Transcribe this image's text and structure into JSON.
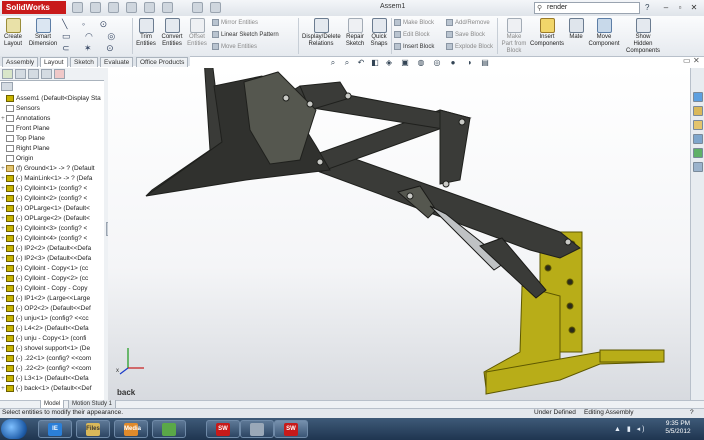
{
  "window": {
    "app_name": "SolidWorks",
    "doc_title": "Assem1",
    "search_placeholder": "render",
    "help": "?",
    "win_controls": [
      "–",
      "▫",
      "✕"
    ]
  },
  "ribbon": {
    "buttons": [
      {
        "label": "Create\nLayout"
      },
      {
        "label": "Smart\nDimension"
      },
      {
        "label": "Trim\nEntities"
      },
      {
        "label": "Convert\nEntities"
      },
      {
        "label": "Offset\nEntities"
      },
      {
        "label": "Display/Delete\nRelations"
      },
      {
        "label": "Repair\nSketch"
      },
      {
        "label": "Quick\nSnaps"
      },
      {
        "label": "Make\nPart from\nBlock"
      },
      {
        "label": "Insert\nComponents"
      },
      {
        "label": "Mate"
      },
      {
        "label": "Move\nComponent"
      },
      {
        "label": "Show\nHidden\nComponents"
      }
    ],
    "small": {
      "mirror": "Mirror Entities",
      "linear_pattern": "Linear Sketch Pattern",
      "move": "Move Entities",
      "make_block": "Make Block",
      "edit_block": "Edit Block",
      "insert_block": "Insert Block",
      "add_remove": "Add/Remove",
      "save_block": "Save Block",
      "explode_block": "Explode Block"
    }
  },
  "command_tabs": [
    "Assembly",
    "Layout",
    "Sketch",
    "Evaluate",
    "Office Products"
  ],
  "command_tab_active": "Layout",
  "tree": [
    {
      "t": "Assem1  (Default<Display Stat",
      "pm": "",
      "icon": "a"
    },
    {
      "t": "Sensors",
      "pm": "",
      "icon": "p"
    },
    {
      "t": "Annotations",
      "pm": "+",
      "icon": "p"
    },
    {
      "t": "Front Plane",
      "pm": "",
      "icon": "p"
    },
    {
      "t": "Top Plane",
      "pm": "",
      "icon": "p"
    },
    {
      "t": "Right Plane",
      "pm": "",
      "icon": "p"
    },
    {
      "t": "Origin",
      "pm": "",
      "icon": "p"
    },
    {
      "t": "(f) Ground<1> -> ? (Default",
      "pm": "+",
      "icon": "f"
    },
    {
      "t": "(-) MainLink<1> -> ? (Defa",
      "pm": "+",
      "icon": "a"
    },
    {
      "t": "(-) Cylloint<1> (config? <",
      "pm": "+",
      "icon": "a"
    },
    {
      "t": "(-) Cylloint<2> (config? <",
      "pm": "+",
      "icon": "a"
    },
    {
      "t": "(-) OPLarge<1> (Default<",
      "pm": "+",
      "icon": "a"
    },
    {
      "t": "(-) OPLarge<2> (Default<",
      "pm": "+",
      "icon": "a"
    },
    {
      "t": "(-) Cylloint<3> (config? <",
      "pm": "+",
      "icon": "a"
    },
    {
      "t": "(-) Cylloint<4> (config? <",
      "pm": "+",
      "icon": "a"
    },
    {
      "t": "(-) IP2<2> (Default<<Defa",
      "pm": "+",
      "icon": "a"
    },
    {
      "t": "(-) IP2<3> (Default<<Defa",
      "pm": "+",
      "icon": "a"
    },
    {
      "t": "(-) Cylloint - Copy<1> (cc",
      "pm": "+",
      "icon": "a"
    },
    {
      "t": "(-) Cylloint - Copy<2> (cc",
      "pm": "+",
      "icon": "a"
    },
    {
      "t": "(-) Cylloint - Copy - Copy",
      "pm": "+",
      "icon": "a"
    },
    {
      "t": "(-) IP1<2> (Large<<Large",
      "pm": "+",
      "icon": "a"
    },
    {
      "t": "(-) OP2<2> (Default<<Def",
      "pm": "+",
      "icon": "a"
    },
    {
      "t": "(-) unju<1> (config? <<cc",
      "pm": "+",
      "icon": "a"
    },
    {
      "t": "(-) L4<2> (Default<<Defa",
      "pm": "+",
      "icon": "a"
    },
    {
      "t": "(-) unju - Copy<1> (confi",
      "pm": "+",
      "icon": "a"
    },
    {
      "t": "(-) shovel support<1> (De",
      "pm": "+",
      "icon": "a"
    },
    {
      "t": "(-) .22<1> (config? <<com",
      "pm": "+",
      "icon": "a"
    },
    {
      "t": "(-) .22<2> (config? <<com",
      "pm": "+",
      "icon": "a"
    },
    {
      "t": "(-) L3<1> (Default<<Defa",
      "pm": "+",
      "icon": "a"
    },
    {
      "t": "(-) back<1> (Default<<Def",
      "pm": "+",
      "icon": "a"
    }
  ],
  "viewport": {
    "triad_label": "x",
    "watermark": "back"
  },
  "model_tabs": [
    "Model",
    "Motion Study 1"
  ],
  "status": {
    "hint": "Select entities to modify their appearance.",
    "state": "Under Defined",
    "mode": "Editing Assembly",
    "help": "?"
  },
  "taskbar": {
    "time": "9:35 PM",
    "date": "5/5/2012",
    "apps": [
      "IE",
      "Files",
      "Media",
      "SW",
      "SW",
      "SW"
    ]
  },
  "colors": {
    "part_dark": "#3a3b38",
    "part_mid": "#55574f",
    "frame_yellow": "#b8ad18",
    "solidworks_red": "#c81a1a"
  }
}
